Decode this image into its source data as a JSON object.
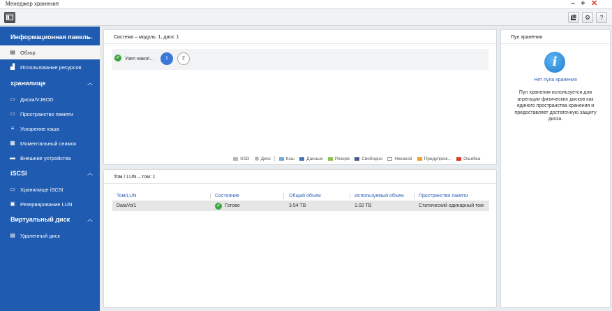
{
  "window": {
    "title": "Менеджер хранения",
    "controls": [
      "–",
      "+",
      "✕"
    ]
  },
  "toolbar": {
    "right_buttons": [
      "qtier-icon",
      "gear-icon",
      "help-icon"
    ],
    "help_label": "?"
  },
  "sidebar": {
    "sections": [
      {
        "label": "Информационная панель",
        "items": [
          "Обзор",
          "Использование ресурсов"
        ]
      },
      {
        "label": "хранилище",
        "items": [
          "Диски/VJBOD",
          "Пространство памяти",
          "Ускорение кэша",
          "Моментальный снимок",
          "Внешние устройства"
        ]
      },
      {
        "label": "iSCSI",
        "items": [
          "Хранилище iSCSI",
          "Резервирование LUN"
        ]
      },
      {
        "label": "Виртуальный диск",
        "items": [
          "Удаленный диск"
        ]
      }
    ],
    "active_item": "Обзор"
  },
  "system_panel": {
    "title": "Система – модуль: 1, диск: 1",
    "node_label": "Узел накоп...",
    "pages": [
      "1",
      "2"
    ],
    "legend": [
      {
        "label": "SSD",
        "color": "#b5b5b5"
      },
      {
        "label": "Диск",
        "color": "#b5b5b5"
      },
      {
        "label": "Кэш",
        "color": "#6aaee0"
      },
      {
        "label": "Данные",
        "color": "#4a73b5"
      },
      {
        "label": "Резерв",
        "color": "#8bc34a"
      },
      {
        "label": "Свободно",
        "color": "#4a5a8a"
      },
      {
        "label": "Никакой",
        "color": "#ffffff"
      },
      {
        "label": "Предупреж...",
        "color": "#f0a020"
      },
      {
        "label": "Ошибка",
        "color": "#d63a2f"
      }
    ]
  },
  "volume_panel": {
    "title": "Том / LUN – том: 1",
    "columns": [
      "Том/LUN",
      "Состояние",
      "Общий объем",
      "Используемый объем",
      "Пространство памяти"
    ],
    "rows": [
      {
        "name": "DataVol1",
        "status": "Готово",
        "total": "3.54 TB",
        "used": "1.02 TB",
        "space": "Статический одинарный том"
      }
    ]
  },
  "pool_panel": {
    "title": "Пул хранения",
    "info_glyph": "i",
    "no_pool": "Нет пула хранения",
    "description": "Пул хранения используется для агрегации физических дисков как единого пространства хранения и предоставляет достаточную защиту диска."
  },
  "colors": {
    "sidebar_bg": "#1f5bb0",
    "accent_blue": "#2d62b6",
    "ok_green": "#3aa53f",
    "close_red": "#d63a2f"
  }
}
